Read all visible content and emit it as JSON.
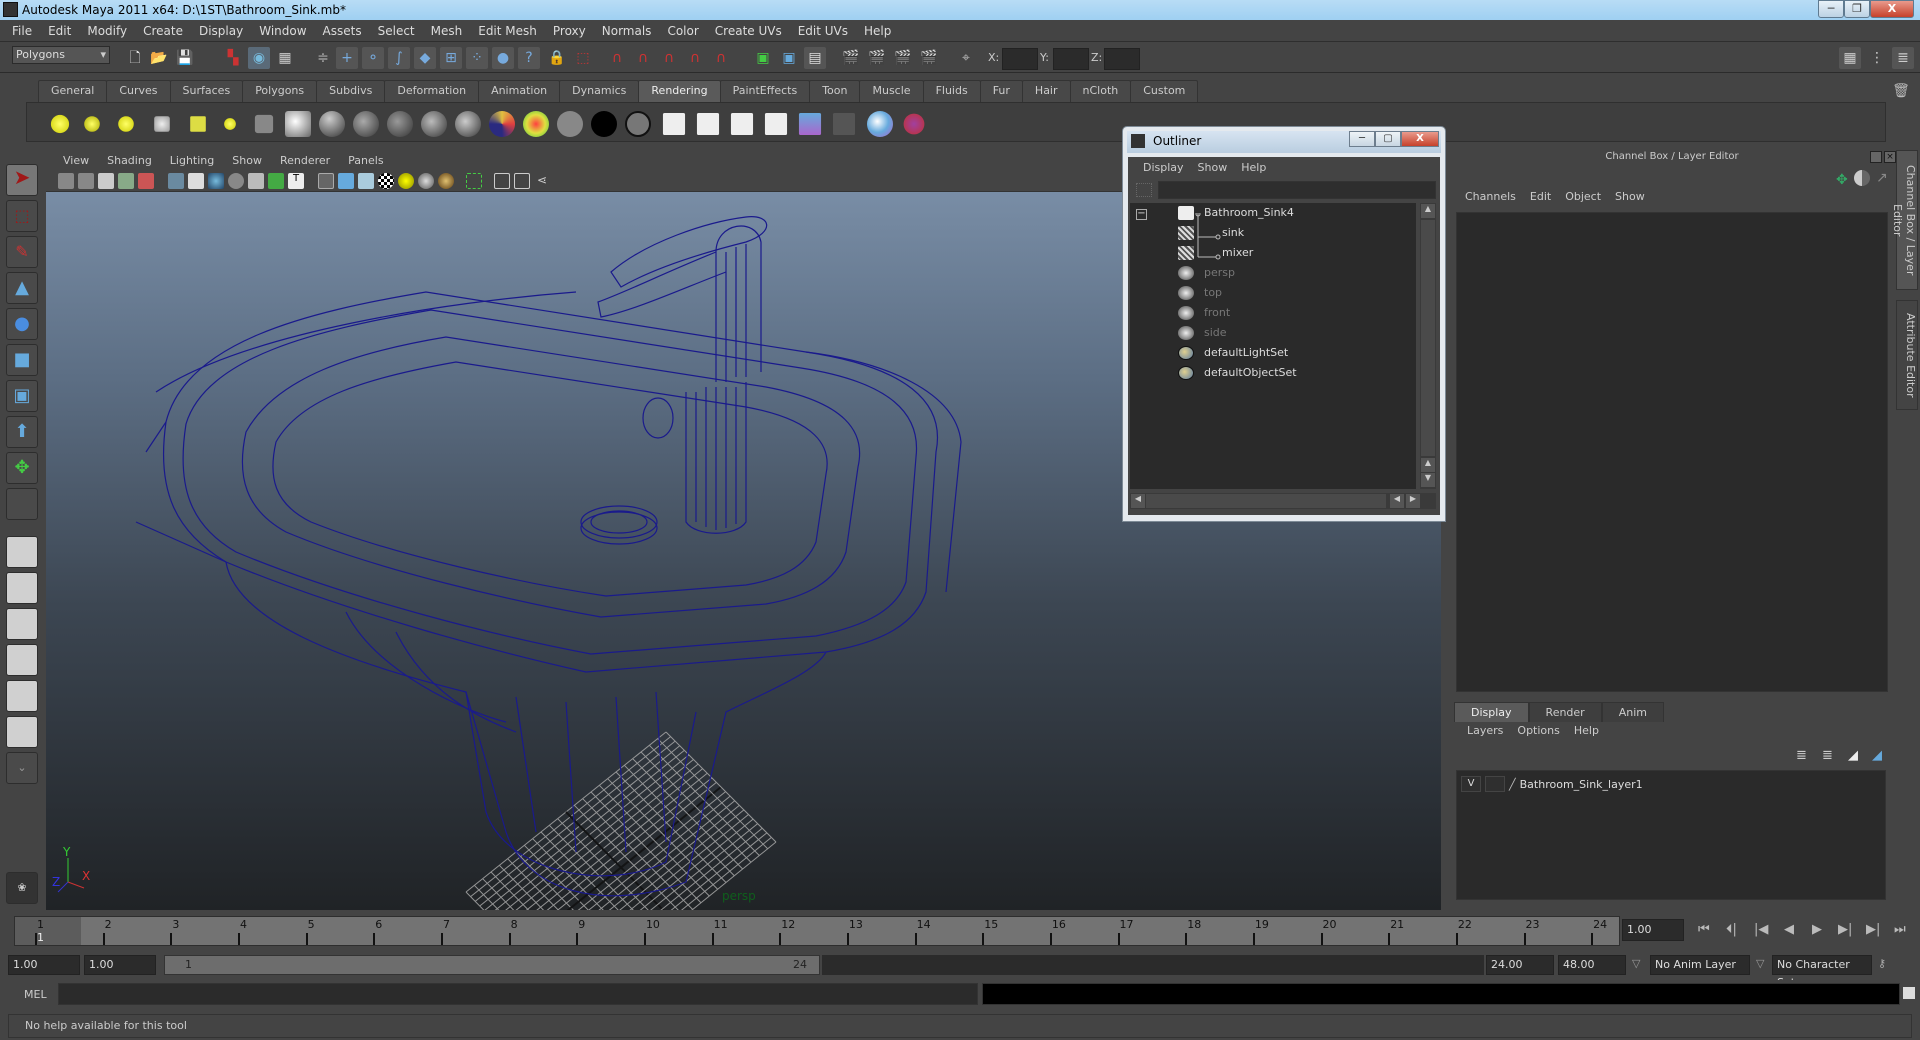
{
  "window": {
    "title": "Autodesk Maya 2011 x64: D:\\1ST\\Bathroom_Sink.mb*",
    "minimize": "─",
    "maximize": "❐",
    "close": "X"
  },
  "menubar": [
    "File",
    "Edit",
    "Modify",
    "Create",
    "Display",
    "Window",
    "Assets",
    "Select",
    "Mesh",
    "Edit Mesh",
    "Proxy",
    "Normals",
    "Color",
    "Create UVs",
    "Edit UVs",
    "Help"
  ],
  "statusline": {
    "mode": "Polygons",
    "x_label": "X:",
    "y_label": "Y:",
    "z_label": "Z:",
    "x_value": "",
    "y_value": "",
    "z_value": ""
  },
  "shelf": {
    "tabs": [
      "General",
      "Curves",
      "Surfaces",
      "Polygons",
      "Subdivs",
      "Deformation",
      "Animation",
      "Dynamics",
      "Rendering",
      "PaintEffects",
      "Toon",
      "Muscle",
      "Fluids",
      "Fur",
      "Hair",
      "nCloth",
      "Custom"
    ],
    "active_tab": "Rendering",
    "icons": [
      "ambient-light-icon",
      "directional-light-icon",
      "point-light-icon",
      "spot-light-icon",
      "area-light-icon",
      "volume-light-icon",
      "camera-icon",
      "hypershade-icon",
      "blinn-icon",
      "lambert-icon",
      "phong-icon",
      "phonge-icon",
      "anisotropic-icon",
      "ramp-shader-icon",
      "layered-shader-icon",
      "surface-shader-icon",
      "use-background-icon",
      "shading-map-icon",
      "render-view-icon",
      "ipr-render-icon",
      "batch-render-icon",
      "render-settings-icon",
      "hypershade-window-icon",
      "light-linking-icon",
      "paint-tool-icon"
    ]
  },
  "viewport": {
    "menu": [
      "View",
      "Shading",
      "Lighting",
      "Show",
      "Renderer",
      "Panels"
    ],
    "camera_label": "persp",
    "axis": {
      "x": "X",
      "y": "Y",
      "z": "Z"
    },
    "colors": {
      "wireframe": "#1a1a8c",
      "grid": "#b0b0b0",
      "camera_label": "#0f5f1c"
    }
  },
  "outliner": {
    "title": "Outliner",
    "menu": [
      "Display",
      "Show",
      "Help"
    ],
    "filter": "",
    "items": [
      {
        "label": "Bathroom_Sink4",
        "icon": "group-icon",
        "level": 0,
        "dim": false,
        "expanded": true
      },
      {
        "label": "sink",
        "icon": "mesh-icon",
        "level": 1,
        "dim": false
      },
      {
        "label": "mixer",
        "icon": "mesh-icon",
        "level": 1,
        "dim": false
      },
      {
        "label": "persp",
        "icon": "camera-icon",
        "level": 0,
        "dim": true
      },
      {
        "label": "top",
        "icon": "camera-icon",
        "level": 0,
        "dim": true
      },
      {
        "label": "front",
        "icon": "camera-icon",
        "level": 0,
        "dim": true
      },
      {
        "label": "side",
        "icon": "camera-icon",
        "level": 0,
        "dim": true
      },
      {
        "label": "defaultLightSet",
        "icon": "set-icon",
        "level": 0,
        "dim": false
      },
      {
        "label": "defaultObjectSet",
        "icon": "set-icon",
        "level": 0,
        "dim": false
      }
    ]
  },
  "channelbox": {
    "title": "Channel Box / Layer Editor",
    "menu": [
      "Channels",
      "Edit",
      "Object",
      "Show"
    ],
    "layer_tabs": [
      "Display",
      "Render",
      "Anim"
    ],
    "active_layer_tab": "Display",
    "layer_menu": [
      "Layers",
      "Options",
      "Help"
    ],
    "layers": [
      {
        "visible": "V",
        "template": "",
        "name": "Bathroom_Sink_layer1"
      }
    ]
  },
  "side_tabs": [
    "Channel Box / Layer Editor",
    "Attribute Editor"
  ],
  "timeslider": {
    "ticks": [
      "1",
      "2",
      "3",
      "4",
      "5",
      "6",
      "7",
      "8",
      "9",
      "10",
      "11",
      "12",
      "13",
      "14",
      "15",
      "16",
      "17",
      "18",
      "19",
      "20",
      "21",
      "22",
      "23",
      "24"
    ],
    "current_frame_marker": "1",
    "current_time": "1.00"
  },
  "playback": [
    "go-to-start-icon",
    "step-back-key-icon",
    "step-back-frame-icon",
    "play-backwards-icon",
    "play-forwards-icon",
    "step-forward-frame-icon",
    "step-forward-key-icon",
    "go-to-end-icon"
  ],
  "rangeslider": {
    "start_time": "1.00",
    "playback_start": "1.00",
    "range_start": "1",
    "range_end": "24",
    "playback_end": "24.00",
    "end_time": "48.00",
    "anim_layer": "No Anim Layer",
    "character_set": "No Character Set"
  },
  "commandline": {
    "label": "MEL",
    "input": "",
    "output": ""
  },
  "helpline": {
    "text": "No help available for this tool"
  }
}
